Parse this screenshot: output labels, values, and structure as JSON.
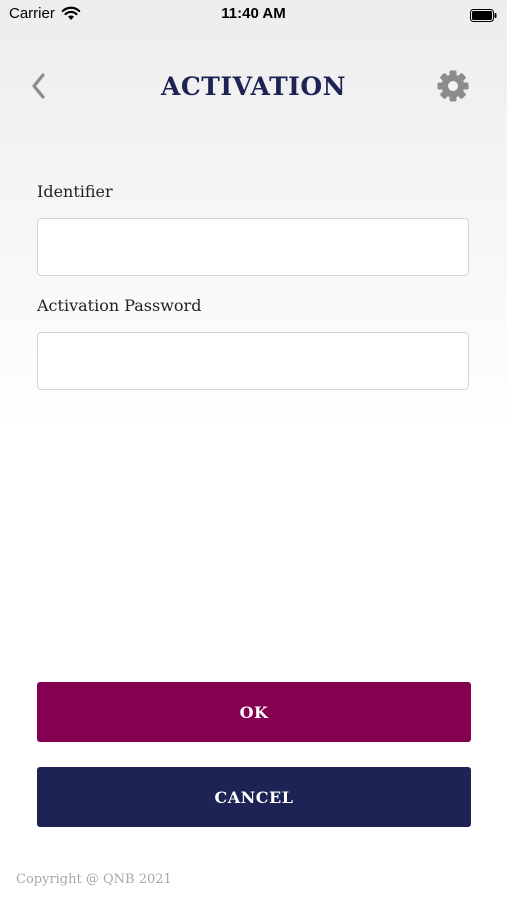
{
  "status_bar": {
    "carrier": "Carrier",
    "time": "11:40 AM",
    "icons": [
      "wifi-icon",
      "battery-icon"
    ]
  },
  "header": {
    "title": "ACTIVATION",
    "back_icon": "chevron-left-icon",
    "settings_icon": "gear-icon"
  },
  "form": {
    "identifier_label": "Identifier",
    "identifier_value": "",
    "password_label": "Activation Password",
    "password_value": ""
  },
  "buttons": {
    "ok_label": "OK",
    "cancel_label": "CANCEL"
  },
  "footer": {
    "copyright": "Copyright @ QNB 2021"
  },
  "colors": {
    "title": "#1d2354",
    "ok_button": "#850050",
    "cancel_button": "#1d2354",
    "footer_text": "#a8a8a8"
  }
}
